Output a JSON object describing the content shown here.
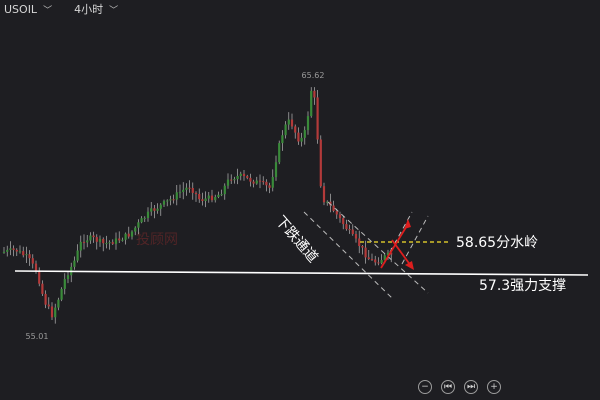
{
  "toolbar": {
    "symbol": "USOIL",
    "timeframe": "4小时"
  },
  "chart_data": {
    "type": "candlestick",
    "high_label": "65.62",
    "low_label": "55.01",
    "colors": {
      "up": "#3a8a3a",
      "down": "#b33a3a",
      "wick": "#cfcfcf",
      "support": "#ffffff",
      "resistance": "#d4c02a",
      "arrow": "#dd1e1e"
    },
    "annotations": {
      "channel": "下跌通道",
      "resistance": "58.65分水岭",
      "support": "57.3强力支撑",
      "watermark": "投顾网"
    }
  },
  "controls": {
    "zoom_out": "−",
    "prev": "⏮",
    "next": "⏭",
    "zoom_in": "+"
  }
}
